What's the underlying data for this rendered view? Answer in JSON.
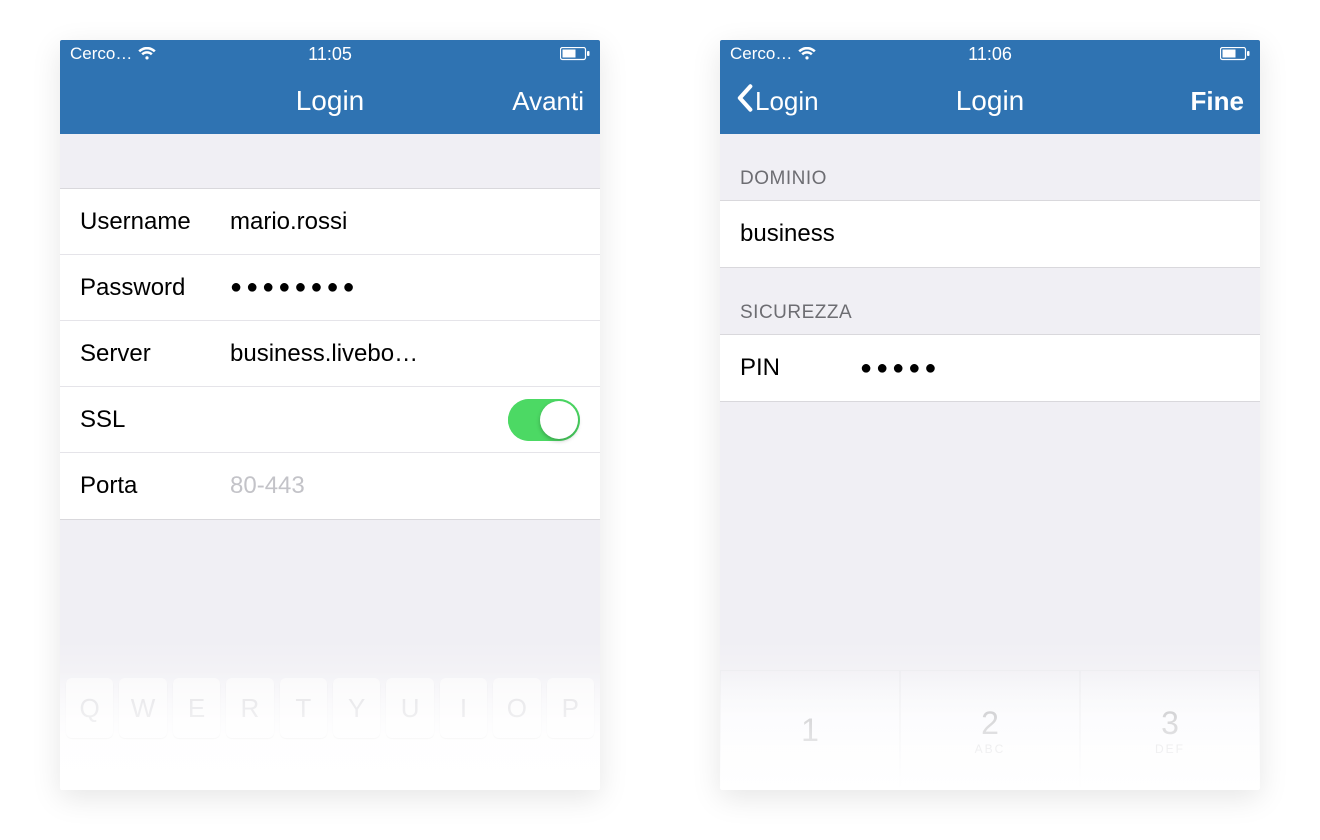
{
  "left": {
    "status": {
      "carrier": "Cerco…",
      "time": "11:05"
    },
    "nav": {
      "title": "Login",
      "right": "Avanti"
    },
    "rows": {
      "username": {
        "label": "Username",
        "value": "mario.rossi"
      },
      "password": {
        "label": "Password",
        "value": "●●●●●●●●"
      },
      "server": {
        "label": "Server",
        "value": "business.livebo…"
      },
      "ssl": {
        "label": "SSL",
        "on": true
      },
      "port": {
        "label": "Porta",
        "placeholder": "80-443"
      }
    },
    "qwerty": [
      "Q",
      "W",
      "E",
      "R",
      "T",
      "Y",
      "U",
      "I",
      "O",
      "P"
    ]
  },
  "right": {
    "status": {
      "carrier": "Cerco…",
      "time": "11:06"
    },
    "nav": {
      "back": "Login",
      "title": "Login",
      "right": "Fine"
    },
    "sections": {
      "dominio": {
        "header": "DOMINIO",
        "value": "business"
      },
      "sicurezza": {
        "header": "SICUREZZA",
        "pin_label": "PIN",
        "pin_value": "●●●●●"
      }
    },
    "numpad": [
      {
        "digit": "1",
        "letters": ""
      },
      {
        "digit": "2",
        "letters": "ABC"
      },
      {
        "digit": "3",
        "letters": "DEF"
      }
    ]
  }
}
